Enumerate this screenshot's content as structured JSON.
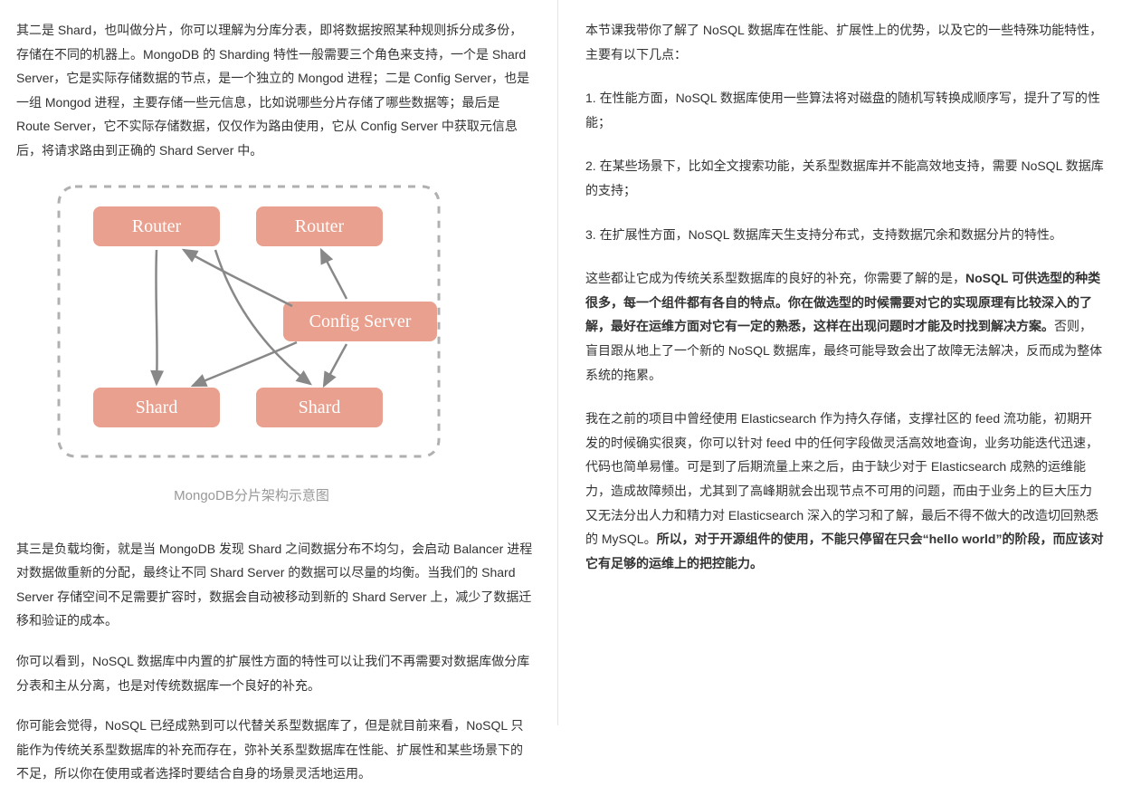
{
  "left": {
    "p1": "其二是 Shard，也叫做分片，你可以理解为分库分表，即将数据按照某种规则拆分成多份，存储在不同的机器上。MongoDB 的 Sharding 特性一般需要三个角色来支持，一个是 Shard Server，它是实际存储数据的节点，是一个独立的 Mongod 进程；二是 Config Server，也是一组 Mongod 进程，主要存储一些元信息，比如说哪些分片存储了哪些数据等；最后是 Route Server，它不实际存储数据，仅仅作为路由使用，它从 Config Server 中获取元信息后，将请求路由到正确的 Shard Server 中。",
    "diagram": {
      "router1": "Router",
      "router2": "Router",
      "config": "Config Server",
      "shard1": "Shard",
      "shard2": "Shard",
      "caption": "MongoDB分片架构示意图"
    },
    "p2": "其三是负载均衡，就是当 MongoDB 发现 Shard 之间数据分布不均匀，会启动 Balancer 进程对数据做重新的分配，最终让不同 Shard Server 的数据可以尽量的均衡。当我们的 Shard Server 存储空间不足需要扩容时，数据会自动被移动到新的 Shard Server 上，减少了数据迁移和验证的成本。",
    "p3": "你可以看到，NoSQL 数据库中内置的扩展性方面的特性可以让我们不再需要对数据库做分库分表和主从分离，也是对传统数据库一个良好的补充。",
    "p4": "你可能会觉得，NoSQL 已经成熟到可以代替关系型数据库了，但是就目前来看，NoSQL 只能作为传统关系型数据库的补充而存在，弥补关系型数据库在性能、扩展性和某些场景下的不足，所以你在使用或者选择时要结合自身的场景灵活地运用。"
  },
  "right": {
    "p1": "本节课我带你了解了 NoSQL 数据库在性能、扩展性上的优势，以及它的一些特殊功能特性，主要有以下几点：",
    "p2": "1. 在性能方面，NoSQL 数据库使用一些算法将对磁盘的随机写转换成顺序写，提升了写的性能；",
    "p3": "2. 在某些场景下，比如全文搜索功能，关系型数据库并不能高效地支持，需要 NoSQL 数据库的支持；",
    "p4": "3. 在扩展性方面，NoSQL 数据库天生支持分布式，支持数据冗余和数据分片的特性。",
    "p5a": "这些都让它成为传统关系型数据库的良好的补充，你需要了解的是，",
    "p5b": "NoSQL 可供选型的种类很多，每一个组件都有各自的特点。你在做选型的时候需要对它的实现原理有比较深入的了解，最好在运维方面对它有一定的熟悉，这样在出现问题时才能及时找到解决方案。",
    "p5c": "否则，盲目跟从地上了一个新的 NoSQL 数据库，最终可能导致会出了故障无法解决，反而成为整体系统的拖累。",
    "p6a": "我在之前的项目中曾经使用 Elasticsearch 作为持久存储，支撑社区的 feed 流功能，初期开发的时候确实很爽，你可以针对 feed 中的任何字段做灵活高效地查询，业务功能迭代迅速，代码也简单易懂。可是到了后期流量上来之后，由于缺少对于 Elasticsearch 成熟的运维能力，造成故障频出，尤其到了高峰期就会出现节点不可用的问题，而由于业务上的巨大压力又无法分出人力和精力对 Elasticsearch 深入的学习和了解，最后不得不做大的改造切回熟悉的 MySQL。",
    "p6b": "所以，对于开源组件的使用，不能只停留在只会“hello world”的阶段，而应该对它有足够的运维上的把控能力。"
  }
}
